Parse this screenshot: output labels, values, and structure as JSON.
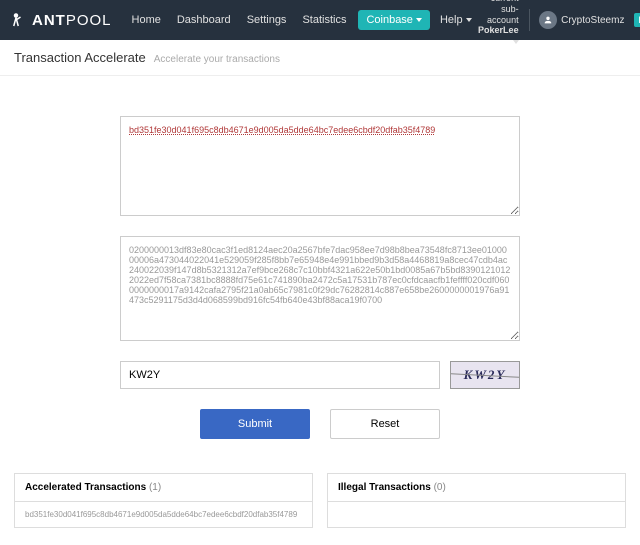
{
  "nav": {
    "brand": "ANT",
    "brand2": "POOL",
    "links": [
      "Home",
      "Dashboard",
      "Settings",
      "Statistics"
    ],
    "coinbase": "Coinbase",
    "help": "Help",
    "subaccount_label": "current sub-account",
    "subaccount_value": "PokerLee",
    "username": "CryptoSteemz",
    "lang": "EN"
  },
  "header": {
    "title": "Transaction Accelerate",
    "subtitle": "Accelerate your transactions"
  },
  "form": {
    "txid": "bd351fe30d041f695c8db4671e9d005da5dde64bc7edee6cbdf20dfab35f4789",
    "raw": "0200000013df83e80cac3f1ed8124aec20a2567bfe7dac958ee7d98b8bea73548fc8713ee0100000006a473044022041e529059f285f8bb7e65948e4e991bbed9b3d58a4468819a8cec47cdb4ac240022039f147d8b5321312a7ef9bce268c7c10bbf4321a622e50b1bd0085a67b5bd83901210122022ed7f58ca7381bc8888fd75e61c741890ba2472c5a17531b787ec0cfdcaacfb1feffff020cdf0600000000017a9142cafa2795f21a0ab65c7981c0f29dc76282814c887e658be2600000001976a91473c5291175d3d4d068599bd916fc54fb640e43bf88aca19f0700",
    "captcha_value": "KW2Y",
    "captcha_display": "KW2Y",
    "submit": "Submit",
    "reset": "Reset"
  },
  "panels": {
    "accelerated": {
      "title": "Accelerated Transactions",
      "count": "(1)",
      "item": "bd351fe30d041f695c8db4671e9d005da5dde64bc7edee6cbdf20dfab35f4789"
    },
    "illegal": {
      "title": "Illegal Transactions",
      "count": "(0)"
    }
  }
}
